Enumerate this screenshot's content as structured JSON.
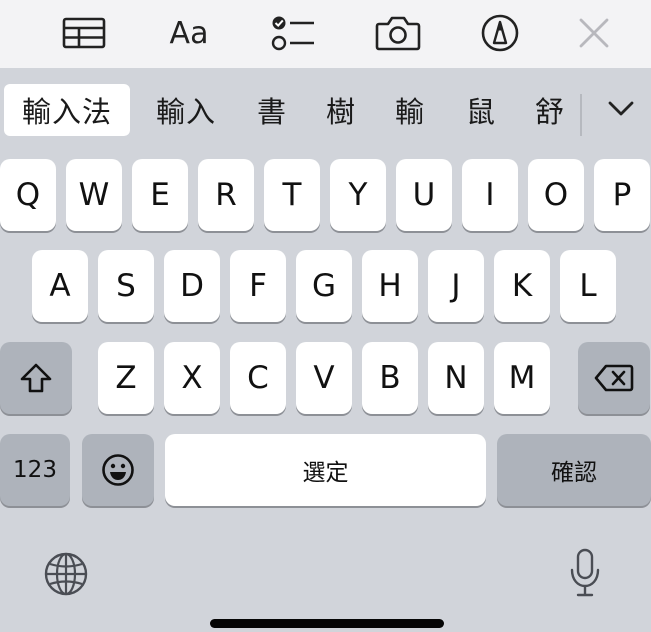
{
  "toolbar": {
    "icons": [
      "table-icon",
      "text-format-icon",
      "checklist-icon",
      "camera-icon",
      "markup-icon",
      "close-icon"
    ],
    "text_format_label": "Aa"
  },
  "candidates": [
    "輸入法",
    "輸入",
    "書",
    "樹",
    "輸",
    "鼠",
    "舒"
  ],
  "selected_candidate_index": 0,
  "keyboard": {
    "row1": [
      "Q",
      "W",
      "E",
      "R",
      "T",
      "Y",
      "U",
      "I",
      "O",
      "P"
    ],
    "row2": [
      "A",
      "S",
      "D",
      "F",
      "G",
      "H",
      "J",
      "K",
      "L"
    ],
    "row3": [
      "Z",
      "X",
      "C",
      "V",
      "B",
      "N",
      "M"
    ],
    "numbers_label": "123",
    "space_label": "選定",
    "return_label": "確認"
  },
  "colors": {
    "keyboard_bg": "#d1d4da",
    "key_bg": "#ffffff",
    "function_key_bg": "#aeb3bb",
    "toolbar_bg": "#f3f3f5"
  }
}
